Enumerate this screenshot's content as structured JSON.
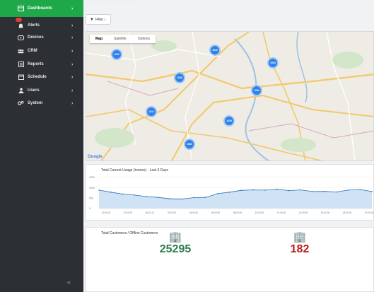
{
  "topbar": {
    "text": "··· ····· ····· ··· ····· ········· ····· ········ ····· ····"
  },
  "sidebar": {
    "items": [
      {
        "label": "Dashboards",
        "icon": "dashboard-icon",
        "active": true
      },
      {
        "label": "Alerts",
        "icon": "bell-icon",
        "badge": ""
      },
      {
        "label": "Devices",
        "icon": "device-icon"
      },
      {
        "label": "CRM",
        "icon": "users-group-icon"
      },
      {
        "label": "Reports",
        "icon": "report-icon"
      },
      {
        "label": "Schedule",
        "icon": "calendar-icon"
      },
      {
        "label": "Users",
        "icon": "user-icon"
      },
      {
        "label": "System",
        "icon": "gears-icon"
      }
    ],
    "collapse_label": "«"
  },
  "filter": {
    "label": "Filter ›"
  },
  "map": {
    "tabs": [
      "Map",
      "Satellite",
      "Options"
    ],
    "clusters": [
      "1301",
      "1620",
      "1993",
      "1528",
      "1284",
      "1414",
      "1039",
      "1880"
    ],
    "attribution": "Google"
  },
  "usage": {
    "title": "Total Current Usage (tonnes) - Last 3 Days",
    "y_ticks": [
      "1500",
      "1000",
      "500",
      "0"
    ],
    "x_ticks": [
      "20:00:00",
      "22:00:00",
      "06-03-21",
      "02:00:00",
      "04:00:00",
      "06:00:00",
      "08:00:00",
      "10:00:00",
      "12:00:00",
      "14:00:00",
      "16:00:00",
      "18:00:00",
      "20:00:00"
    ],
    "fill_color": "#cfe3f5",
    "line_color": "#2f6fb5"
  },
  "chart_data": {
    "type": "area",
    "title": "Total Current Usage (tonnes) - Last 3 Days",
    "x": [
      "20:00:00",
      "22:00:00",
      "06-03-21",
      "02:00:00",
      "04:00:00",
      "06:00:00",
      "08:00:00",
      "10:00:00",
      "12:00:00",
      "14:00:00",
      "16:00:00",
      "18:00:00",
      "20:00:00"
    ],
    "ylim": [
      0,
      1500
    ],
    "series": [
      {
        "values": [
          890,
          790,
          700,
          650,
          580,
          540,
          470,
          460,
          530,
          540,
          720,
          790,
          880,
          900,
          890,
          930,
          870,
          900,
          820,
          830,
          800,
          890,
          920,
          820
        ]
      }
    ]
  },
  "customers": {
    "title": "Total Customers / Offline Customers",
    "total": "25295",
    "offline": "182",
    "total_color": "#2e7d4f",
    "offline_color": "#b71c1c"
  }
}
